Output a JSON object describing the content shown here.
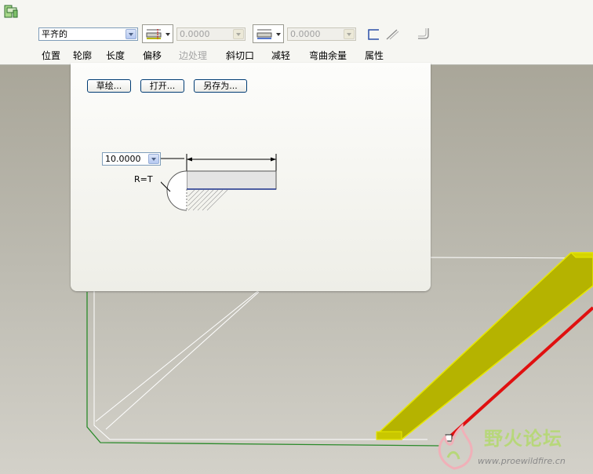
{
  "toolbar": {
    "placement_value": "平齐的",
    "thickness_value_1": "0.0000",
    "thickness_value_2": "0.0000"
  },
  "tabs": [
    {
      "label": "位置",
      "enabled": true
    },
    {
      "label": "轮廓",
      "enabled": true,
      "active": true
    },
    {
      "label": "长度",
      "enabled": true
    },
    {
      "label": "偏移",
      "enabled": true
    },
    {
      "label": "边处理",
      "enabled": false
    },
    {
      "label": "斜切口",
      "enabled": true
    },
    {
      "label": "减轻",
      "enabled": true
    },
    {
      "label": "弯曲余量",
      "enabled": true
    },
    {
      "label": "属性",
      "enabled": true
    }
  ],
  "profile_panel": {
    "sketch_button": "草绘...",
    "open_button": "打开...",
    "save_as_button": "另存为...",
    "length_value": "10.0000",
    "radius_label": "R=T"
  },
  "watermark": {
    "title": "野火论坛",
    "url": "www.proewildfire.cn"
  },
  "colors": {
    "wall_fill": "#b5b300",
    "wall_edge": "#e8e800",
    "wall_highlight": "#e01010",
    "sketch_green": "#2a8a2a"
  }
}
